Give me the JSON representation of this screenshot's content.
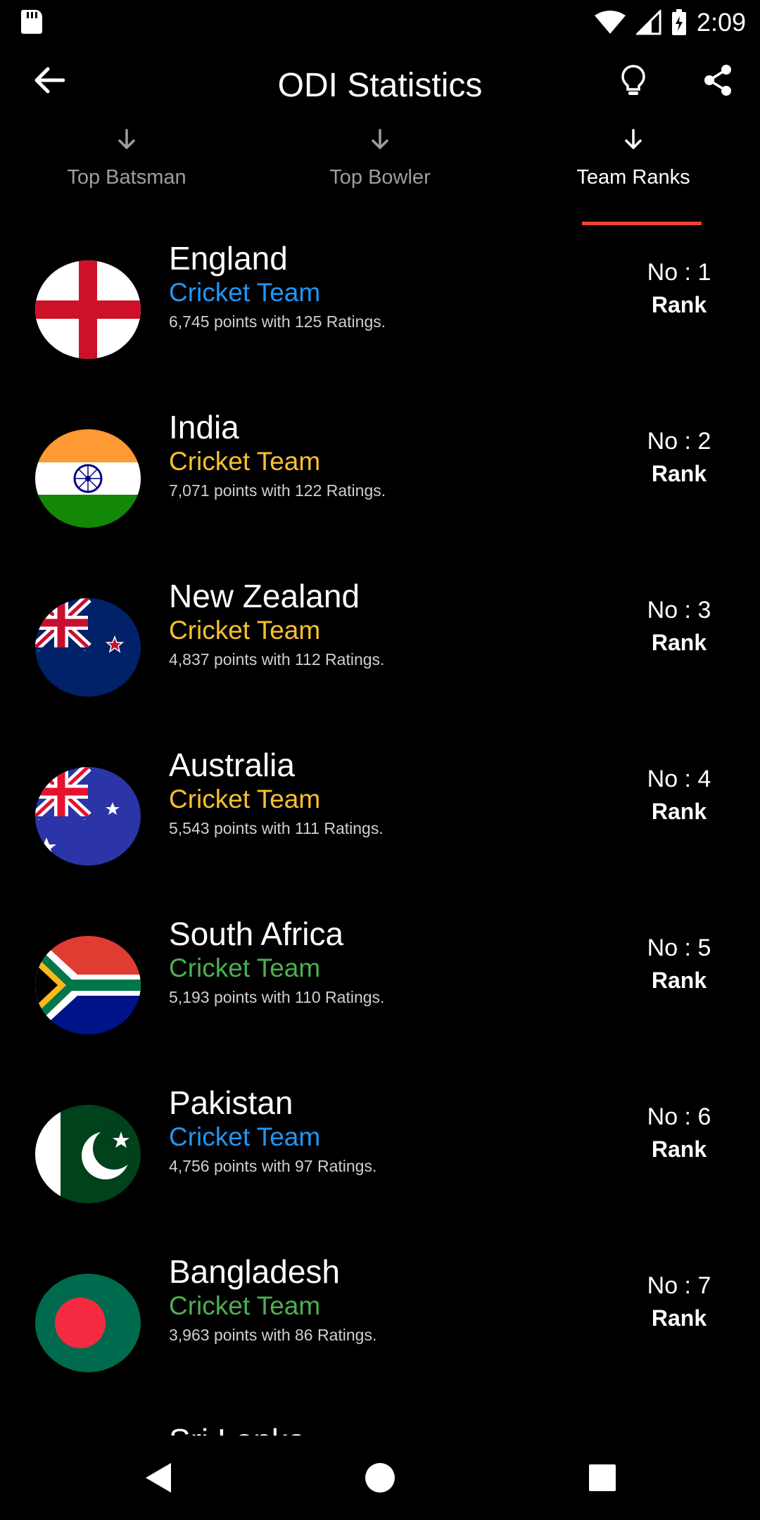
{
  "status_bar": {
    "time": "2:09"
  },
  "app_bar": {
    "title": "ODI Statistics"
  },
  "tabs": [
    {
      "label": "Top Batsman",
      "active": false
    },
    {
      "label": "Top Bowler",
      "active": false
    },
    {
      "label": "Team Ranks",
      "active": true
    }
  ],
  "colors": {
    "accent_tab_indicator": "#f44336",
    "blue": "#2196f3",
    "yellow": "#fbc02d",
    "green": "#4caf50"
  },
  "teams": [
    {
      "name": "England",
      "subtitle": "Cricket Team",
      "subtitle_color": "#2196f3",
      "points": "6,745 points with 125 Ratings.",
      "rank_no": "No : 1",
      "rank_label": "Rank",
      "flag": "england-flag-icon"
    },
    {
      "name": "India",
      "subtitle": "Cricket Team",
      "subtitle_color": "#fbc02d",
      "points": "7,071 points with 122 Ratings.",
      "rank_no": "No : 2",
      "rank_label": "Rank",
      "flag": "india-flag-icon"
    },
    {
      "name": "New Zealand",
      "subtitle": "Cricket Team",
      "subtitle_color": "#fbc02d",
      "points": "4,837 points with 112 Ratings.",
      "rank_no": "No : 3",
      "rank_label": "Rank",
      "flag": "new-zealand-flag-icon"
    },
    {
      "name": "Australia",
      "subtitle": "Cricket Team",
      "subtitle_color": "#fbc02d",
      "points": "5,543 points with 111 Ratings.",
      "rank_no": "No : 4",
      "rank_label": "Rank",
      "flag": "australia-flag-icon"
    },
    {
      "name": "South Africa",
      "subtitle": "Cricket Team",
      "subtitle_color": "#4caf50",
      "points": "5,193 points with 110 Ratings.",
      "rank_no": "No : 5",
      "rank_label": "Rank",
      "flag": "south-africa-flag-icon"
    },
    {
      "name": "Pakistan",
      "subtitle": "Cricket Team",
      "subtitle_color": "#2196f3",
      "points": "4,756 points with 97 Ratings.",
      "rank_no": "No : 6",
      "rank_label": "Rank",
      "flag": "pakistan-flag-icon"
    },
    {
      "name": "Bangladesh",
      "subtitle": "Cricket Team",
      "subtitle_color": "#4caf50",
      "points": "3,963 points with 86 Ratings.",
      "rank_no": "No : 7",
      "rank_label": "Rank",
      "flag": "bangladesh-flag-icon"
    }
  ],
  "partial_next_team": "Sri Lanka",
  "icons": {
    "back": "arrow-back-icon",
    "bulb": "lightbulb-icon",
    "share": "share-icon",
    "tab_arrow": "arrow-down-icon",
    "nav_back": "nav-back-icon",
    "nav_home": "nav-home-icon",
    "nav_recents": "nav-recents-icon"
  }
}
